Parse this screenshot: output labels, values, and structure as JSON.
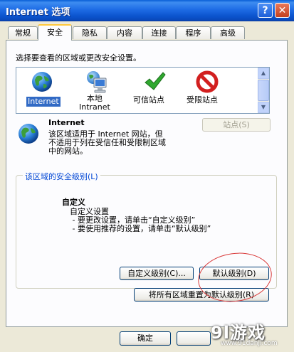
{
  "window": {
    "title": "Internet 选项",
    "help_label": "?",
    "close_label": "✕"
  },
  "tabs": [
    {
      "label": "常规"
    },
    {
      "label": "安全"
    },
    {
      "label": "隐私"
    },
    {
      "label": "内容"
    },
    {
      "label": "连接"
    },
    {
      "label": "程序"
    },
    {
      "label": "高级"
    }
  ],
  "security": {
    "instruction": "选择要查看的区域或更改安全设置。",
    "zones": [
      {
        "label": "Internet",
        "icon": "globe-icon"
      },
      {
        "label": "本地\nIntranet",
        "icon": "computer-icon"
      },
      {
        "label": "可信站点",
        "icon": "checkmark-icon"
      },
      {
        "label": "受限站点",
        "icon": "no-entry-icon"
      }
    ],
    "zone_title": "Internet",
    "zone_description": "该区域适用于 Internet 网站，但\n不适用于列在受信任和受限制区域\n中的网站。",
    "sites_button": "站点(S)",
    "level_group_label": "该区域的安全级别(L)",
    "level_title": "自定义",
    "level_text": "自定义设置\n - 要更改设置，请单击“自定义级别”\n - 要使用推荐的设置，请单击“默认级别”",
    "custom_level_button": "自定义级别(C)...",
    "default_level_button": "默认级别(D)",
    "reset_all_button": "将所有区域重置为默认级别(R)"
  },
  "footer": {
    "ok_button": "确定"
  },
  "watermark": {
    "logo": "9l游戏",
    "url": "www.91danji.com"
  },
  "colors": {
    "titlebar": "#0b52cc",
    "selection": "#316ac5",
    "annotation": "#d93a3a"
  }
}
